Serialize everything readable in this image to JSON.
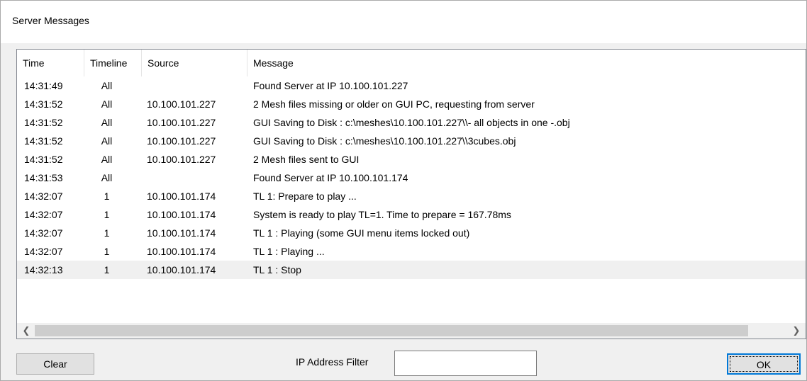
{
  "window": {
    "title": "Server Messages"
  },
  "table": {
    "columns": [
      "Time",
      "Timeline",
      "Source",
      "Message"
    ],
    "rows": [
      {
        "time": "14:31:49",
        "timeline": "All",
        "source": "",
        "message": "Found Server at IP 10.100.101.227"
      },
      {
        "time": "14:31:52",
        "timeline": "All",
        "source": "10.100.101.227",
        "message": "2 Mesh files missing or older on GUI PC, requesting from server"
      },
      {
        "time": "14:31:52",
        "timeline": "All",
        "source": "10.100.101.227",
        "message": "GUI Saving to Disk : c:\\meshes\\10.100.101.227\\\\- all objects in one -.obj"
      },
      {
        "time": "14:31:52",
        "timeline": "All",
        "source": "10.100.101.227",
        "message": "GUI Saving to Disk : c:\\meshes\\10.100.101.227\\\\3cubes.obj"
      },
      {
        "time": "14:31:52",
        "timeline": "All",
        "source": "10.100.101.227",
        "message": "2 Mesh files sent to GUI"
      },
      {
        "time": "14:31:53",
        "timeline": "All",
        "source": "",
        "message": "Found Server at IP 10.100.101.174"
      },
      {
        "time": "14:32:07",
        "timeline": "1",
        "source": "10.100.101.174",
        "message": "TL 1: Prepare to play ..."
      },
      {
        "time": "14:32:07",
        "timeline": "1",
        "source": "10.100.101.174",
        "message": "System is ready to play TL=1. Time to prepare = 167.78ms"
      },
      {
        "time": "14:32:07",
        "timeline": "1",
        "source": "10.100.101.174",
        "message": "TL 1 : Playing (some GUI menu items locked out)"
      },
      {
        "time": "14:32:07",
        "timeline": "1",
        "source": "10.100.101.174",
        "message": "TL 1 : Playing ..."
      },
      {
        "time": "14:32:13",
        "timeline": "1",
        "source": "10.100.101.174",
        "message": "TL 1 : Stop"
      }
    ],
    "selected_row": 10
  },
  "scrollbar": {
    "left_icon": "chevron-left-icon",
    "right_icon": "chevron-right-icon"
  },
  "footer": {
    "clear_label": "Clear",
    "filter_label": "IP Address Filter",
    "filter_value": "",
    "ok_label": "OK"
  }
}
